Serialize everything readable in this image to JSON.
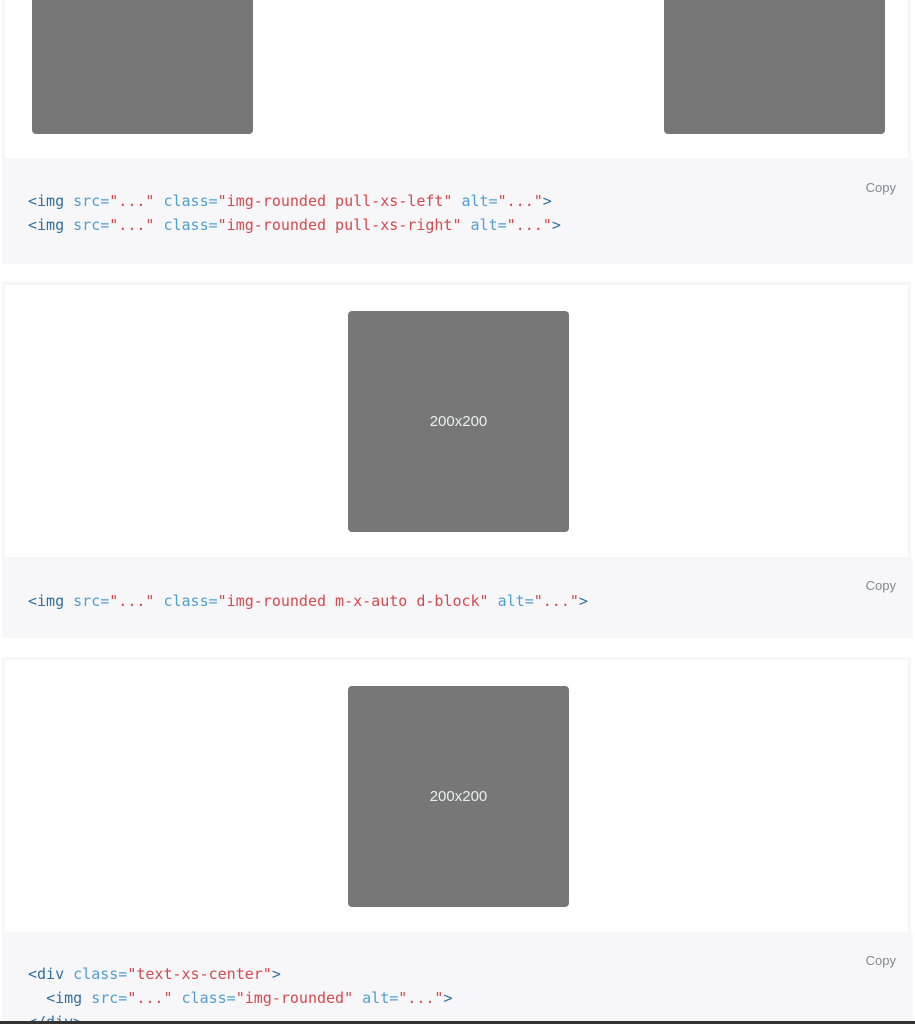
{
  "placeholders": {
    "label": "200x200"
  },
  "copy_label": "Copy",
  "snippets": {
    "float": {
      "line1": {
        "open": "<img",
        "src_attr": "src=",
        "src_val": "\"...\"",
        "class_attr": "class=",
        "class_val": "\"img-rounded pull-xs-left\"",
        "alt_attr": "alt=",
        "alt_val": "\"...\"",
        "close": ">"
      },
      "line2": {
        "open": "<img",
        "src_attr": "src=",
        "src_val": "\"...\"",
        "class_attr": "class=",
        "class_val": "\"img-rounded pull-xs-right\"",
        "alt_attr": "alt=",
        "alt_val": "\"...\"",
        "close": ">"
      }
    },
    "block": {
      "line1": {
        "open": "<img",
        "src_attr": "src=",
        "src_val": "\"...\"",
        "class_attr": "class=",
        "class_val": "\"img-rounded m-x-auto d-block\"",
        "alt_attr": "alt=",
        "alt_val": "\"...\"",
        "close": ">"
      }
    },
    "center": {
      "line1": {
        "open": "<div",
        "class_attr": "class=",
        "class_val": "\"text-xs-center\"",
        "close": ">"
      },
      "line2": {
        "indent": "  ",
        "open": "<img",
        "src_attr": "src=",
        "src_val": "\"...\"",
        "class_attr": "class=",
        "class_val": "\"img-rounded\"",
        "alt_attr": "alt=",
        "alt_val": "\"...\"",
        "close": ">"
      },
      "line3": {
        "close_tag": "</div>"
      }
    }
  },
  "colors": {
    "placeholder_bg": "#777777",
    "code_bg": "#f7f7f9",
    "tag": "#2f6f9f",
    "attr": "#4f9fcf",
    "value": "#d44950",
    "copy": "#818a91"
  }
}
